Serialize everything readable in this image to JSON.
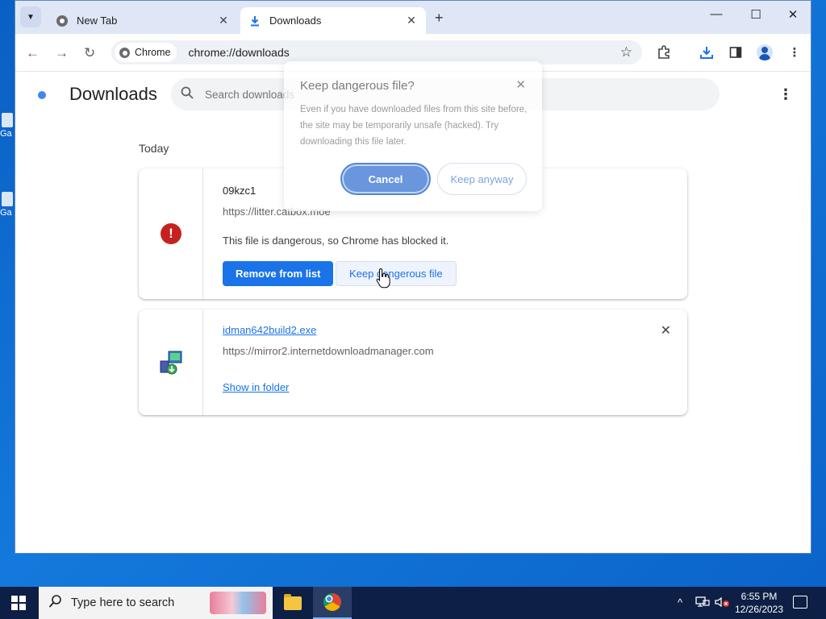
{
  "desktop": {
    "icons": [
      {
        "label": "Ga"
      },
      {
        "label": "Ga"
      }
    ]
  },
  "browser": {
    "tabs": [
      {
        "title": "New Tab",
        "close": "✕"
      },
      {
        "title": "Downloads",
        "close": "✕"
      }
    ],
    "new_tab": "+",
    "window_controls": {
      "minimize": "—",
      "maximize": "☐",
      "close": "✕"
    },
    "toolbar": {
      "chip_label": "Chrome",
      "url": "chrome://downloads"
    }
  },
  "downloads_page": {
    "title": "Downloads",
    "search_placeholder": "Search downloads",
    "section": "Today",
    "items": [
      {
        "name": "09kzc1",
        "url": "https://litter.catbox.moe",
        "message": "This file is dangerous, so Chrome has blocked it.",
        "primary_action": "Remove from list",
        "secondary_action": "Keep dangerous file"
      },
      {
        "name": "idman642build2.exe",
        "url": "https://mirror2.internetdownloadmanager.com",
        "action": "Show in folder"
      }
    ]
  },
  "dialog": {
    "title": "Keep dangerous file?",
    "body": "Even if you have downloaded files from this site before, the site may be temporarily unsafe (hacked). Try downloading this file later.",
    "cancel": "Cancel",
    "keep": "Keep anyway"
  },
  "taskbar": {
    "search_placeholder": "Type here to search",
    "time": "6:55 PM",
    "date": "12/26/2023"
  },
  "colors": {
    "accent": "#1a73e8",
    "danger": "#c5221f",
    "taskbar": "#0d1f44"
  }
}
